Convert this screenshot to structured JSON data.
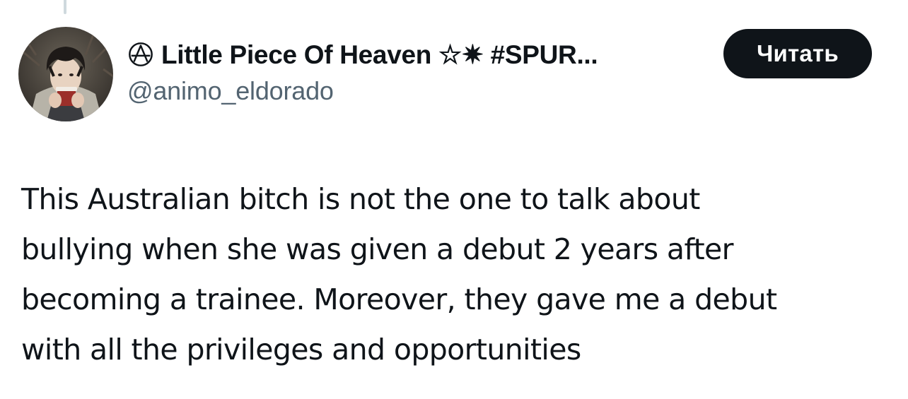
{
  "author": {
    "display_name": "Little Piece Of Heaven ☆✷ #SPUR...",
    "handle": "@animo_eldorado",
    "badge_icon": "anarchy-circle-icon",
    "avatar_icon": "profile-photo"
  },
  "follow_button": {
    "label": "Читать"
  },
  "tweet": {
    "lines": [
      "This Australian bitch is not the one to talk about",
      "bullying when she was given a debut 2 years after",
      "becoming a trainee. Moreover, they gave me a debut",
      "with all the privileges and opportunities"
    ]
  },
  "colors": {
    "text": "#0f1419",
    "secondary": "#536471",
    "button_bg": "#0f1419",
    "button_text": "#ffffff",
    "background": "#ffffff",
    "thread_line": "#cfd9de"
  }
}
